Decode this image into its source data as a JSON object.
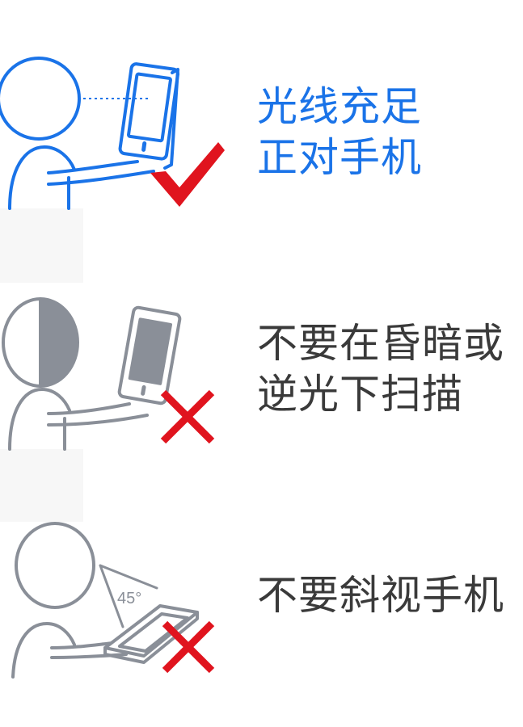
{
  "colors": {
    "good": "#1a73e8",
    "neutral": "#8a8f98",
    "bad": "#e0141e",
    "text_dark": "#3a3a3a",
    "panel_bg": "#f7f7f7"
  },
  "sections": [
    {
      "status": "correct",
      "icon": "checkmark-icon",
      "lines": [
        "光线充足",
        "正对手机"
      ]
    },
    {
      "status": "wrong",
      "icon": "cross-icon",
      "lines": [
        "不要在昏暗或",
        "逆光下扫描"
      ]
    },
    {
      "status": "wrong",
      "icon": "cross-icon",
      "angle_label": "45°",
      "lines": [
        "不要斜视手机"
      ]
    }
  ]
}
